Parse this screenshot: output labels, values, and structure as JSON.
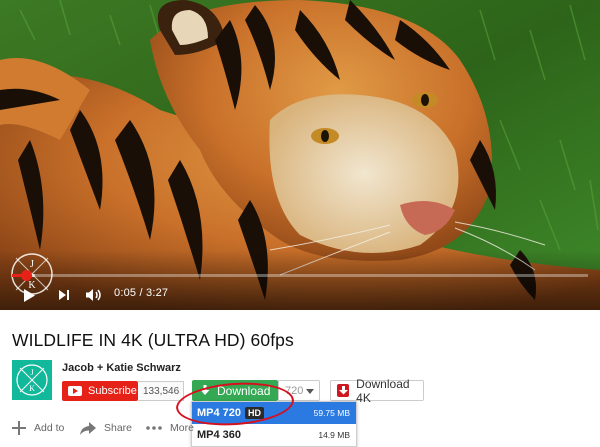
{
  "player": {
    "current_time": "0:05",
    "separator": " / ",
    "duration": "3:27",
    "progress_fraction": 0.025,
    "loaded_fraction": 0.04,
    "watermark_letters": [
      "J",
      "K"
    ]
  },
  "video": {
    "title": "WILDLIFE IN 4K (ULTRA HD) 60fps"
  },
  "channel": {
    "name": "Jacob + Katie Schwarz",
    "avatar_letters": [
      "J",
      "K"
    ],
    "subscribe_label": "Subscribe",
    "subscriber_count": "133,546"
  },
  "download": {
    "button_label": "Download",
    "quality_value": "720",
    "download4k_label": "Download 4K",
    "menu": [
      {
        "format": "MP4 720",
        "badge": "HD",
        "size": "59.75 MB",
        "selected": true
      },
      {
        "format": "MP4 360",
        "badge": "",
        "size": "14.9 MB",
        "selected": false
      }
    ]
  },
  "actions": {
    "add_to": "Add to",
    "share": "Share",
    "more": "More"
  },
  "colors": {
    "accent_red": "#e62117",
    "download_green": "#34a853",
    "menu_highlight": "#2a7ae2",
    "avatar_teal": "#11b89a"
  }
}
